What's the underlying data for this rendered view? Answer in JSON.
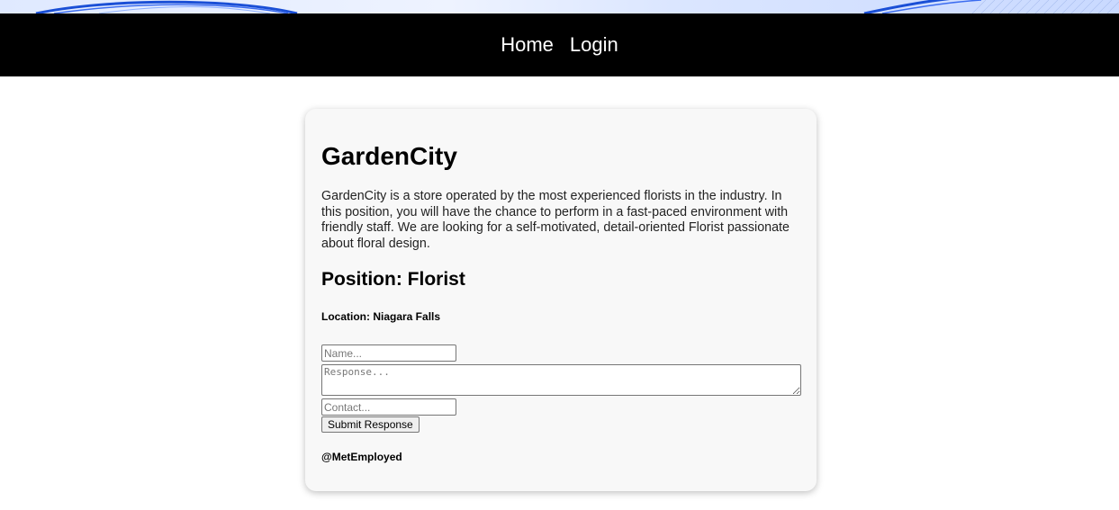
{
  "nav": {
    "home_label": "Home",
    "login_label": "Login"
  },
  "job": {
    "company": "GardenCity",
    "description": "GardenCity is a store operated by the most experienced florists in the industry. In this position, you will have the chance to perform in a fast-paced environment with friendly staff. We are looking for a self-motivated, detail-oriented Florist passionate about floral design.",
    "position": "Position: Florist",
    "location": "Location: Niagara Falls"
  },
  "form": {
    "name_placeholder": "Name...",
    "name_value": "",
    "response_placeholder": "Response...",
    "response_value": "",
    "contact_placeholder": "Contact...",
    "contact_value": "",
    "submit_label": "Submit Response"
  },
  "footer": {
    "handle": "@MetEmployed"
  },
  "colors": {
    "navbar": "#000000",
    "card": "#f8f8f8",
    "banner_accent": "#1a4fd6"
  }
}
